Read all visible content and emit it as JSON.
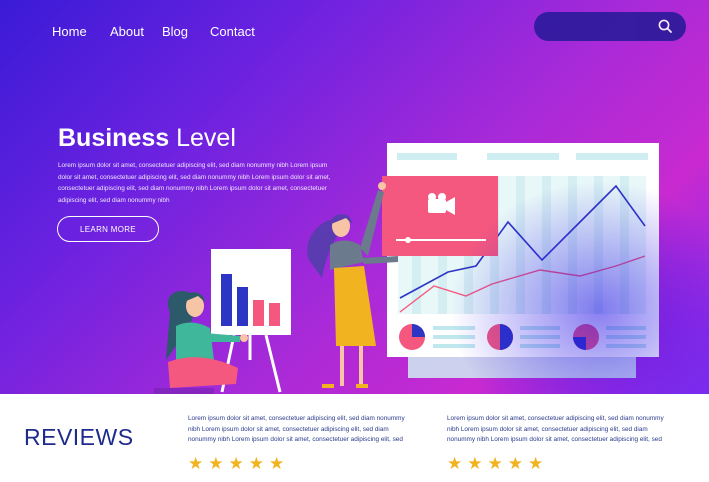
{
  "nav": {
    "items": [
      {
        "label": "Home"
      },
      {
        "label": "About"
      },
      {
        "label": "Blog"
      },
      {
        "label": "Contact"
      }
    ]
  },
  "search": {
    "icon": "search-icon"
  },
  "hero": {
    "title_bold": "Business",
    "title_light": "Level",
    "body": "Lorem ipsum dolor sit amet, consectetuer adipiscing elit, sed diam nonummy nibh Lorem ipsum dolor sit amet, consectetuer adipiscing elit, sed diam nonummy nibh Lorem ipsum dolor sit amet, consectetuer adipiscing elit, sed diam nonummy nibh Lorem ipsum dolor sit amet, consectetuer adipiscing elit, sed diam nonummy nibh",
    "cta_label": "LEARN MORE"
  },
  "reviews": {
    "title": "REVIEWS",
    "items": [
      {
        "text": "Lorem ipsum dolor sit amet, consectetuer adipiscing elit, sed diam nonummy nibh Lorem ipsum dolor sit amet, consectetuer adipiscing elit, sed diam nonummy nibh Lorem ipsum dolor sit amet, consectetuer adipiscing elit, sed",
        "stars": 5
      },
      {
        "text": "Lorem ipsum dolor sit amet, consectetuer adipiscing elit, sed diam nonummy nibh Lorem ipsum dolor sit amet, consectetuer adipiscing elit, sed diam nonummy nibh Lorem ipsum dolor sit amet, consectetuer adipiscing elit, sed",
        "stars": 5
      }
    ]
  },
  "colors": {
    "accent_pink": "#f4587e",
    "navy": "#1e2a8c",
    "star": "#f2b321"
  }
}
